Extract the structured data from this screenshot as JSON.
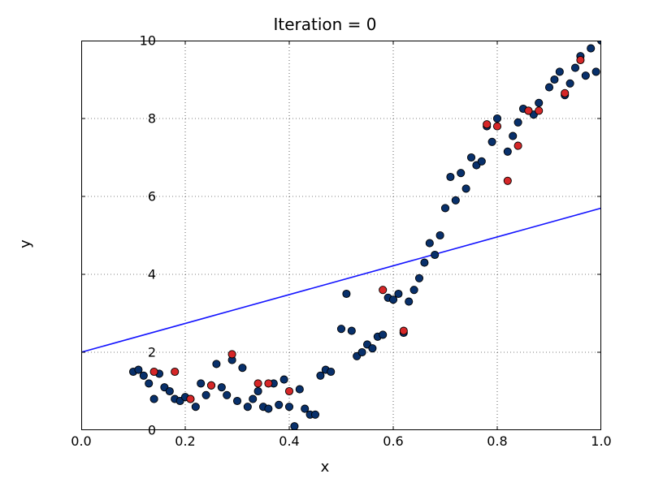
{
  "chart_data": {
    "type": "scatter_with_line",
    "title": "Iteration = 0",
    "xlabel": "x",
    "ylabel": "y",
    "xlim": [
      0.0,
      1.0
    ],
    "ylim": [
      0.0,
      10.0
    ],
    "xticks": [
      0.0,
      0.2,
      0.4,
      0.6,
      0.8,
      1.0
    ],
    "yticks": [
      0,
      2,
      4,
      6,
      8,
      10
    ],
    "grid": true,
    "series": [
      {
        "name": "line-fit",
        "type": "line",
        "color": "#1515ff",
        "x": [
          0.0,
          1.0
        ],
        "y": [
          2.0,
          5.7
        ]
      },
      {
        "name": "points-blue",
        "type": "scatter",
        "color": "#08306b",
        "edge": "#000000",
        "points": [
          [
            0.1,
            1.5
          ],
          [
            0.11,
            1.55
          ],
          [
            0.12,
            1.4
          ],
          [
            0.13,
            1.2
          ],
          [
            0.14,
            0.8
          ],
          [
            0.15,
            1.45
          ],
          [
            0.16,
            1.1
          ],
          [
            0.17,
            1.0
          ],
          [
            0.18,
            0.8
          ],
          [
            0.19,
            0.75
          ],
          [
            0.2,
            0.85
          ],
          [
            0.21,
            0.8
          ],
          [
            0.22,
            0.6
          ],
          [
            0.23,
            1.2
          ],
          [
            0.24,
            0.9
          ],
          [
            0.25,
            1.15
          ],
          [
            0.26,
            1.7
          ],
          [
            0.27,
            1.1
          ],
          [
            0.28,
            0.9
          ],
          [
            0.29,
            1.8
          ],
          [
            0.3,
            0.75
          ],
          [
            0.31,
            1.6
          ],
          [
            0.32,
            0.6
          ],
          [
            0.33,
            0.8
          ],
          [
            0.34,
            1.0
          ],
          [
            0.35,
            0.6
          ],
          [
            0.36,
            0.55
          ],
          [
            0.37,
            1.2
          ],
          [
            0.38,
            0.65
          ],
          [
            0.39,
            1.3
          ],
          [
            0.4,
            0.6
          ],
          [
            0.41,
            0.1
          ],
          [
            0.42,
            1.05
          ],
          [
            0.43,
            0.55
          ],
          [
            0.44,
            0.4
          ],
          [
            0.45,
            0.4
          ],
          [
            0.46,
            1.4
          ],
          [
            0.47,
            1.55
          ],
          [
            0.48,
            1.5
          ],
          [
            0.5,
            2.6
          ],
          [
            0.51,
            3.5
          ],
          [
            0.52,
            2.55
          ],
          [
            0.53,
            1.9
          ],
          [
            0.54,
            2.0
          ],
          [
            0.55,
            2.2
          ],
          [
            0.56,
            2.1
          ],
          [
            0.57,
            2.4
          ],
          [
            0.58,
            2.45
          ],
          [
            0.59,
            3.4
          ],
          [
            0.6,
            3.35
          ],
          [
            0.61,
            3.5
          ],
          [
            0.62,
            2.5
          ],
          [
            0.63,
            3.3
          ],
          [
            0.64,
            3.6
          ],
          [
            0.65,
            3.9
          ],
          [
            0.66,
            4.3
          ],
          [
            0.67,
            4.8
          ],
          [
            0.68,
            4.5
          ],
          [
            0.69,
            5.0
          ],
          [
            0.7,
            5.7
          ],
          [
            0.71,
            6.5
          ],
          [
            0.72,
            5.9
          ],
          [
            0.73,
            6.6
          ],
          [
            0.74,
            6.2
          ],
          [
            0.75,
            7.0
          ],
          [
            0.76,
            6.8
          ],
          [
            0.77,
            6.9
          ],
          [
            0.78,
            7.8
          ],
          [
            0.79,
            7.4
          ],
          [
            0.8,
            8.0
          ],
          [
            0.82,
            7.15
          ],
          [
            0.83,
            7.55
          ],
          [
            0.84,
            7.9
          ],
          [
            0.85,
            8.25
          ],
          [
            0.86,
            8.2
          ],
          [
            0.87,
            8.1
          ],
          [
            0.88,
            8.4
          ],
          [
            0.9,
            8.8
          ],
          [
            0.91,
            9.0
          ],
          [
            0.92,
            9.2
          ],
          [
            0.93,
            8.6
          ],
          [
            0.94,
            8.9
          ],
          [
            0.95,
            9.3
          ],
          [
            0.96,
            9.6
          ],
          [
            0.97,
            9.1
          ],
          [
            0.98,
            9.8
          ],
          [
            0.99,
            9.2
          ],
          [
            1.0,
            10.0
          ]
        ]
      },
      {
        "name": "points-red",
        "type": "scatter",
        "color": "#d62728",
        "edge": "#000000",
        "points": [
          [
            0.14,
            1.5
          ],
          [
            0.18,
            1.5
          ],
          [
            0.21,
            0.8
          ],
          [
            0.25,
            1.15
          ],
          [
            0.29,
            1.95
          ],
          [
            0.34,
            1.2
          ],
          [
            0.36,
            1.2
          ],
          [
            0.4,
            1.0
          ],
          [
            0.58,
            3.6
          ],
          [
            0.62,
            2.55
          ],
          [
            0.78,
            7.85
          ],
          [
            0.8,
            7.8
          ],
          [
            0.82,
            6.4
          ],
          [
            0.84,
            7.3
          ],
          [
            0.86,
            8.2
          ],
          [
            0.88,
            8.2
          ],
          [
            0.93,
            8.65
          ],
          [
            0.96,
            9.5
          ]
        ]
      }
    ]
  }
}
